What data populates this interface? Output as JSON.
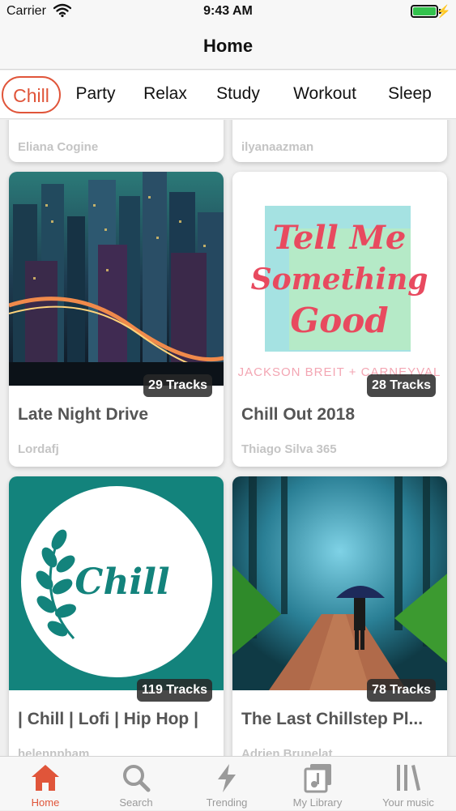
{
  "status_bar": {
    "carrier": "Carrier",
    "time": "9:43 AM",
    "battery_level": 1.0
  },
  "nav": {
    "title": "Home"
  },
  "categories": {
    "active": "Chill",
    "items": [
      "Chill",
      "Party",
      "Relax",
      "Study",
      "Workout",
      "Sleep"
    ]
  },
  "playlists": {
    "partial_top": [
      {
        "author": "Eliana Cogine"
      },
      {
        "author": "ilyanaazman"
      }
    ],
    "cards": [
      {
        "title": "Late Night Drive",
        "author": "Lordafj",
        "tracks": "29 Tracks",
        "art": "city-night"
      },
      {
        "title": "Chill Out 2018",
        "author": "Thiago Silva 365",
        "tracks": "28 Tracks",
        "art": "tell-me-something-good",
        "art_text": {
          "line1": "Tell Me",
          "line2": "Something",
          "line3": "Good",
          "artist": "JACKSON BREIT + CARNEYVAL"
        }
      },
      {
        "title": "| Chill | Lofi | Hip Hop |",
        "author": "helennpham",
        "tracks": "119 Tracks",
        "art": "chill-leaf",
        "art_text": {
          "label": "Chill"
        }
      },
      {
        "title": "The Last Chillstep Pl...",
        "author": "Adrien Brunelat",
        "tracks": "78 Tracks",
        "art": "forest-umbrella"
      }
    ]
  },
  "tab_bar": {
    "active": "Home",
    "items": [
      {
        "label": "Home",
        "icon": "home-icon"
      },
      {
        "label": "Search",
        "icon": "search-icon"
      },
      {
        "label": "Trending",
        "icon": "lightning-icon"
      },
      {
        "label": "My Library",
        "icon": "library-icon"
      },
      {
        "label": "Your music",
        "icon": "books-icon"
      }
    ]
  },
  "colors": {
    "accent": "#e0553a",
    "inactive": "#9a9a9a",
    "teal": "#13837c"
  }
}
